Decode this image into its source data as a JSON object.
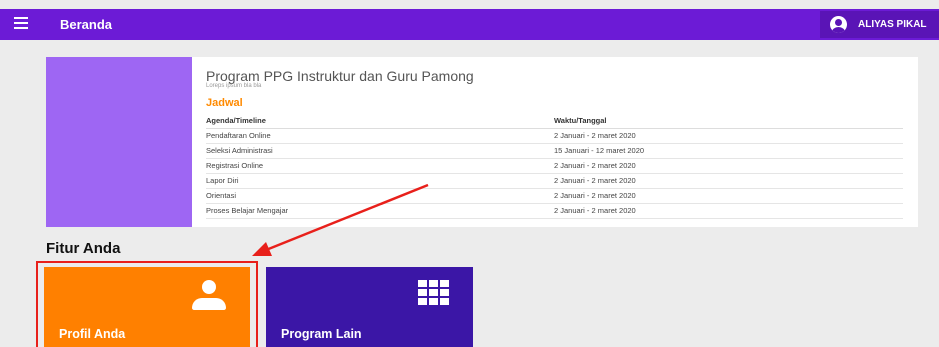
{
  "header": {
    "title": "Beranda",
    "user_name": "ALIYAS PIKAL"
  },
  "program": {
    "title": "Program PPG Instruktur dan Guru Pamong",
    "subtitle": "Loreps ipsum bla bla",
    "schedule_title": "Jadwal",
    "columns": [
      "Agenda/Timeline",
      "Waktu/Tanggal"
    ],
    "rows": [
      {
        "agenda": "Pendaftaran Online",
        "waktu": "2 Januari - 2 maret 2020"
      },
      {
        "agenda": "Seleksi Administrasi",
        "waktu": "15 Januari - 12 maret 2020"
      },
      {
        "agenda": "Registrasi Online",
        "waktu": "2 Januari - 2 maret 2020"
      },
      {
        "agenda": "Lapor Diri",
        "waktu": "2 Januari - 2 maret 2020"
      },
      {
        "agenda": "Orientasi",
        "waktu": "2 Januari - 2 maret 2020"
      },
      {
        "agenda": "Proses Belajar Mengajar",
        "waktu": "2 Januari - 2 maret 2020"
      }
    ]
  },
  "features": {
    "title": "Fitur Anda",
    "tiles": [
      {
        "label": "Profil Anda",
        "icon": "person-icon",
        "color": "#ff8000"
      },
      {
        "label": "Program Lain",
        "icon": "apps-icon",
        "color": "#3b16a6"
      }
    ]
  },
  "colors": {
    "topbar": "#6c1bd6",
    "accent_orange": "#ff8a00",
    "annotation_red": "#e8201b"
  }
}
